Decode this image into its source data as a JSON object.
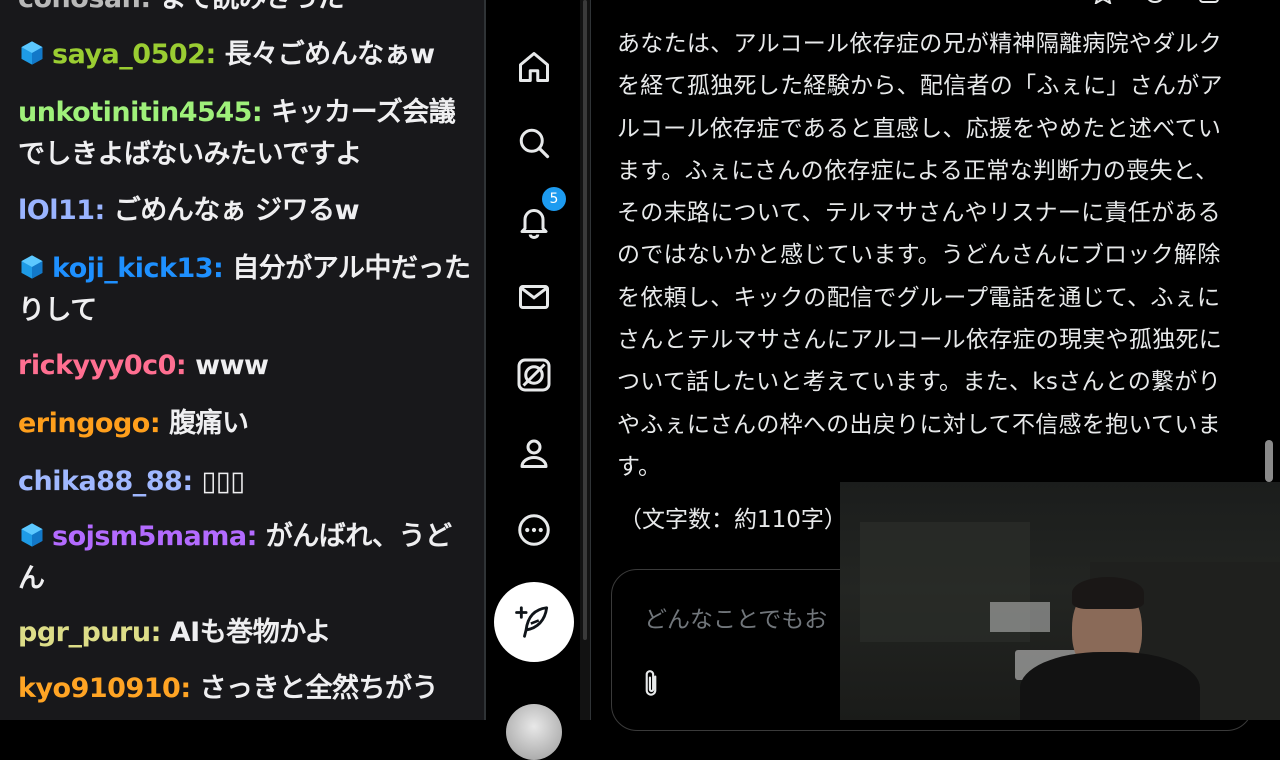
{
  "chat": {
    "messages": [
      {
        "user": "conosan",
        "text": "まで読みきった",
        "color": "#b9b9b9",
        "badge": false
      },
      {
        "user": "saya_0502",
        "text": "長々ごめんなぁw",
        "color": "#9acd32",
        "badge": true
      },
      {
        "user": "unkotinitin4545",
        "text": "キッカーズ会議でしきよばないみたいですよ",
        "color": "#9ff07a",
        "badge": false
      },
      {
        "user": "lOl11",
        "text": "ごめんなぁ ジワるw",
        "color": "#9ab4ff",
        "badge": false
      },
      {
        "user": "koji_kick13",
        "text": "自分がアル中だったりして",
        "color": "#1e90ff",
        "badge": true
      },
      {
        "user": "rickyyy0c0",
        "text": "www",
        "color": "#ff6f91",
        "badge": false
      },
      {
        "user": "eringogo",
        "text": "腹痛い",
        "color": "#ff9f1c",
        "badge": false
      },
      {
        "user": "chika88_88",
        "text": "▯▯▯",
        "color": "#a0b8ff",
        "badge": false
      },
      {
        "user": "sojsm5mama",
        "text": "がんばれ、うどん",
        "color": "#b36bff",
        "badge": true
      },
      {
        "user": "pgr_puru",
        "text": "AIも巻物かよ",
        "color": "#dddd88",
        "badge": false
      },
      {
        "user": "kyo910910",
        "text": "さっきと全然ちがう",
        "color": "#ffa424",
        "badge": false
      }
    ],
    "badge_icon": "cube-badge-icon",
    "separator": ": "
  },
  "sidebar": {
    "items": [
      {
        "name": "home",
        "icon": "home-icon"
      },
      {
        "name": "search",
        "icon": "search-icon"
      },
      {
        "name": "notifications",
        "icon": "bell-icon",
        "badge": "5"
      },
      {
        "name": "messages",
        "icon": "mail-icon"
      },
      {
        "name": "grok",
        "icon": "grok-icon"
      },
      {
        "name": "profile",
        "icon": "person-icon"
      },
      {
        "name": "more",
        "icon": "more-circle-icon"
      }
    ],
    "compose_icon": "feather-plus-icon",
    "accent": "#1d9bf0"
  },
  "main": {
    "answer": "あなたは、アルコール依存症の兄が精神隔離病院やダルクを経て孤独死した経験から、配信者の「ふぇに」さんがアルコール依存症であると直感し、応援をやめたと述べています。ふぇにさんの依存症による正常な判断力の喪失と、その末路について、テルマサさんやリスナーに責任があるのではないかと感じています。うどんさんにブロック解除を依頼し、キックの配信でグループ電話を通じて、ふぇにさんとテルマサさんにアルコール依存症の現実や孤独死について話したいと考えています。また、ksさんとの繋がりやふぇにさんの枠への出戻りに対して不信感を抱いています。",
    "char_count": "（文字数：約110字）",
    "input_placeholder": "どんなことでもお",
    "attach_icon": "paperclip-icon"
  }
}
